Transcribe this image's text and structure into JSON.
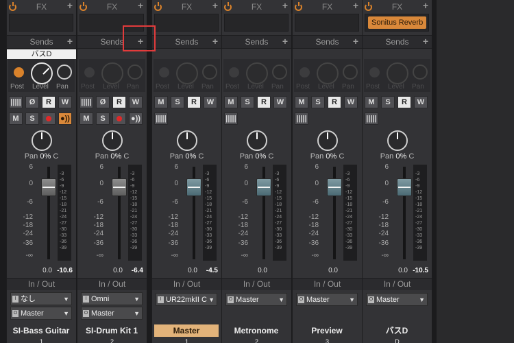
{
  "header": {
    "fx": "FX",
    "sends": "Sends",
    "post": "Post",
    "level": "Level",
    "pan": "Pan",
    "io": "In / Out",
    "plus": "+"
  },
  "buttons": {
    "m": "M",
    "s": "S",
    "r": "R",
    "w": "W",
    "phase": "Ø",
    "mon": "●))",
    "inputIcon": "|||||"
  },
  "strips": [
    {
      "name": "SI-Bass Guitar",
      "number": "1",
      "fx": "",
      "send": "バスD",
      "input": "なし",
      "output": "Master",
      "pan": "0%",
      "panMode": "C",
      "vol": "0.0",
      "peak": "-10.6"
    },
    {
      "name": "SI-Drum Kit 1",
      "number": "2",
      "fx": "",
      "send": "",
      "input": "Omni",
      "output": "Master",
      "pan": "0%",
      "panMode": "C",
      "vol": "0.0",
      "peak": "-6.4"
    },
    {
      "name": "Master",
      "number": "1",
      "fx": "",
      "send": "",
      "input": "UR22mkII C",
      "output": "",
      "pan": "0%",
      "panMode": "C",
      "vol": "0.0",
      "peak": "-4.5"
    },
    {
      "name": "Metronome",
      "number": "2",
      "fx": "",
      "send": "",
      "input": "",
      "output": "Master",
      "pan": "0%",
      "panMode": "C",
      "vol": "0.0",
      "peak": ""
    },
    {
      "name": "Preview",
      "number": "3",
      "fx": "",
      "send": "",
      "input": "",
      "output": "Master",
      "pan": "0%",
      "panMode": "C",
      "vol": "0.0",
      "peak": ""
    },
    {
      "name": "バスD",
      "number": "D",
      "fx": "Sonitus Reverb",
      "send": "",
      "input": "",
      "output": "Master",
      "pan": "0%",
      "panMode": "C",
      "vol": "0.0",
      "peak": "-10.5"
    }
  ],
  "scale": [
    "6",
    "0",
    "-6",
    "-12",
    "-18",
    "-24",
    "-36",
    "-∞"
  ],
  "meterScale": [
    "-3",
    "-6",
    "-9",
    "-12",
    "-15",
    "-18",
    "-21",
    "-24",
    "-27",
    "-30",
    "-33",
    "-36",
    "-39"
  ],
  "colors": {
    "accent": "#d9822b",
    "selectedName": "#e2b37a",
    "highlight": "#e23b3b"
  }
}
